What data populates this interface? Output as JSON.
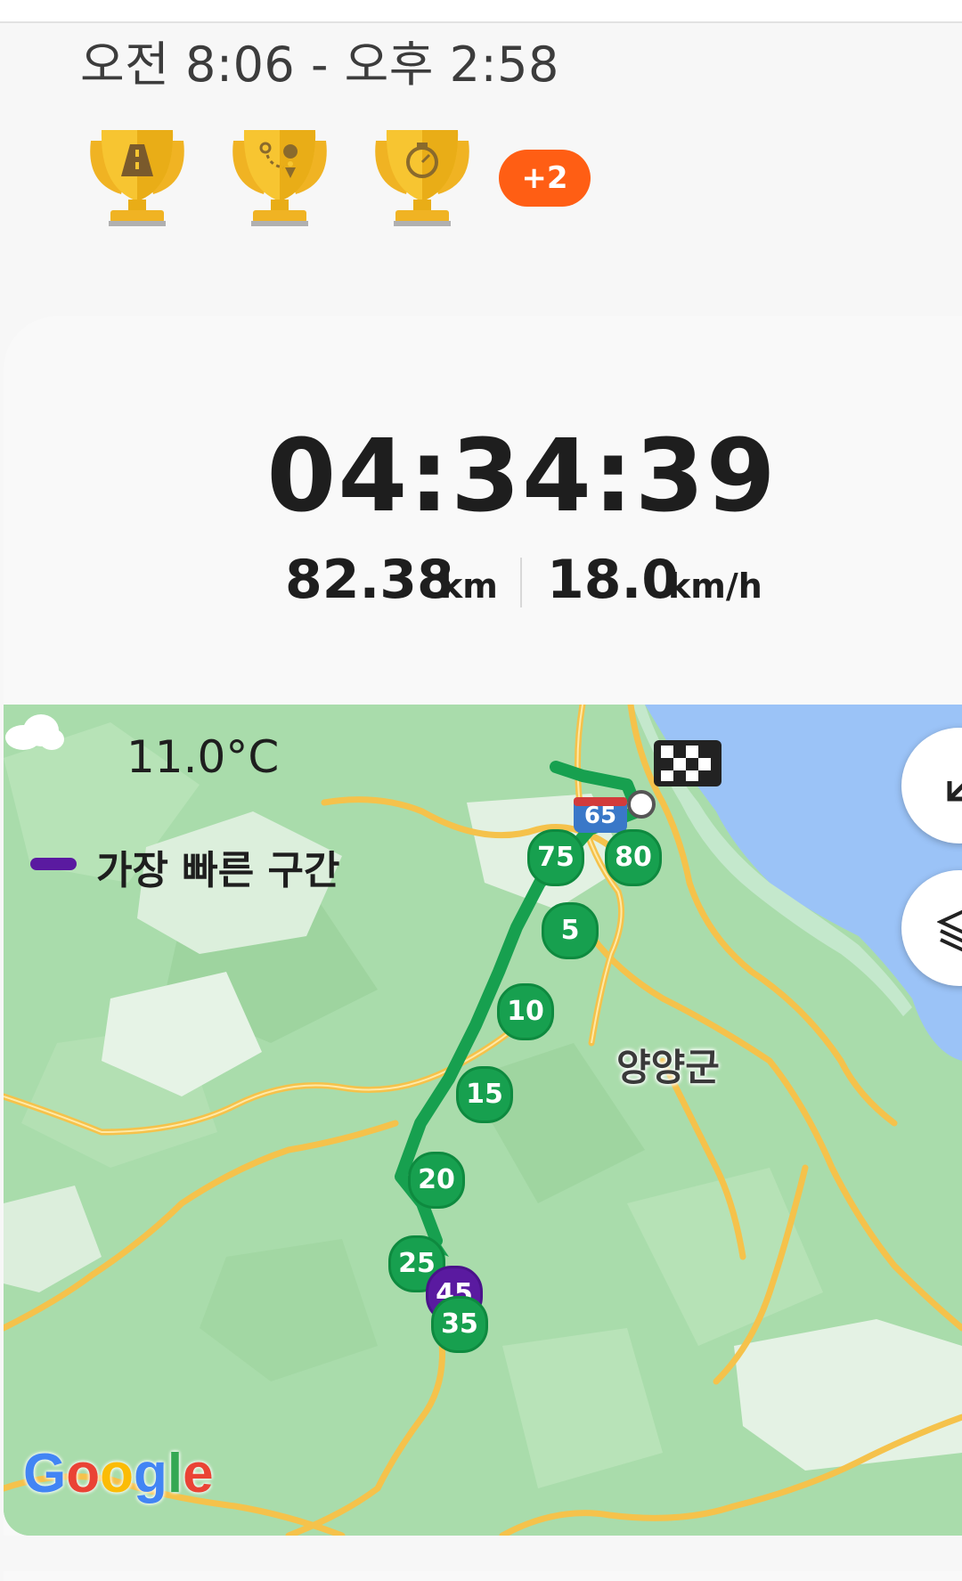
{
  "header": {
    "time_range": "오전 8:06 - 오후 2:58"
  },
  "trophies": [
    {
      "icon": "road-trophy-icon"
    },
    {
      "icon": "route-trophy-icon"
    },
    {
      "icon": "stopwatch-trophy-icon"
    }
  ],
  "more_badge": "+2",
  "summary": {
    "duration": "04:34:39",
    "distance_value": "82.38",
    "distance_unit": "km",
    "speed_value": "18.0",
    "speed_unit": "km/h"
  },
  "map": {
    "weather_icon": "cloud-icon",
    "temperature": "11.0°C",
    "legend_label": "가장 빠른 구간",
    "legend_color": "#5a1aa0",
    "place_name": "양양군",
    "route_color": "#17a04f",
    "highway_shield": "65",
    "km_markers": [
      "75",
      "80",
      "5",
      "10",
      "15",
      "20",
      "25",
      "45",
      "35"
    ],
    "attribution": "Google",
    "buttons": [
      "collapse-arrow-icon",
      "layers-icon"
    ]
  }
}
